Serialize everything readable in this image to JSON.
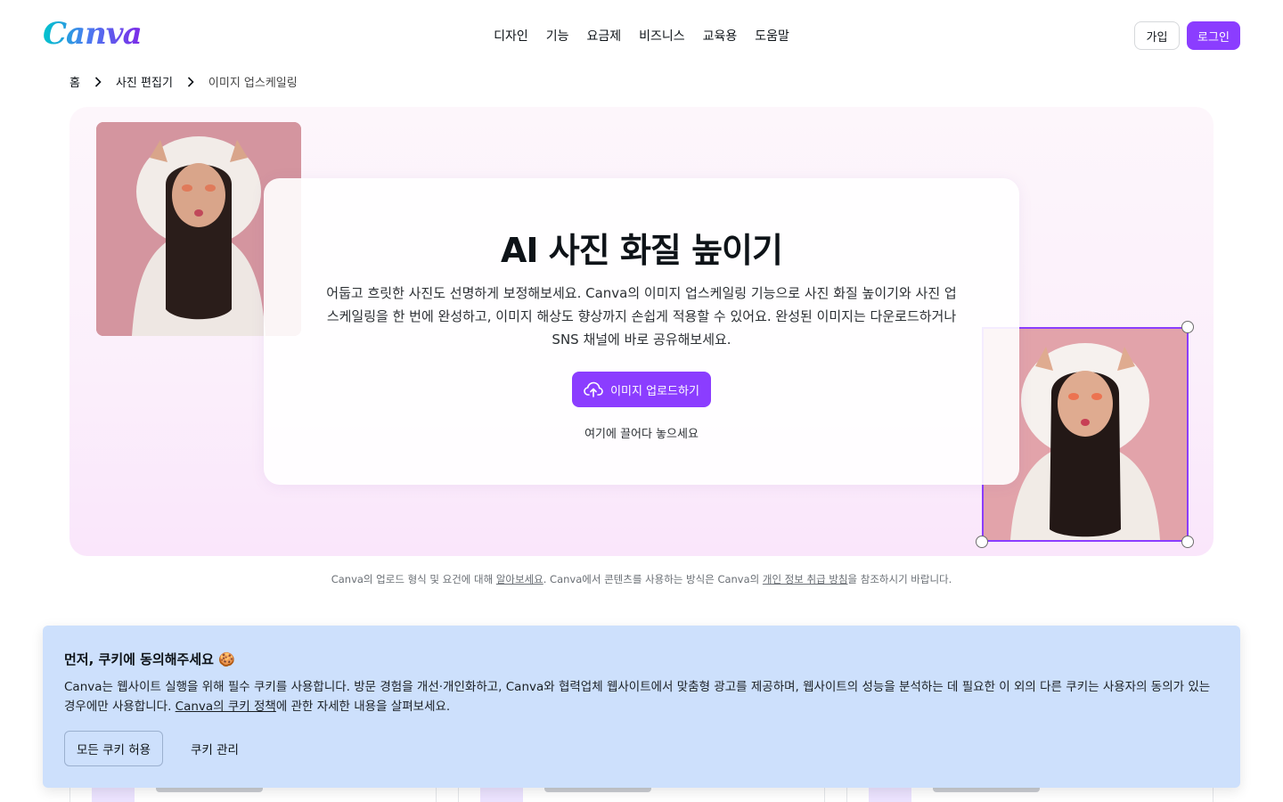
{
  "brand": {
    "name": "Canva",
    "accent": "#8b3dff"
  },
  "nav": {
    "items": [
      {
        "label": "디자인"
      },
      {
        "label": "기능"
      },
      {
        "label": "요금제"
      },
      {
        "label": "비즈니스"
      },
      {
        "label": "교육용"
      },
      {
        "label": "도움말"
      }
    ],
    "signup_label": "가입",
    "login_label": "로그인"
  },
  "breadcrumb": {
    "home": "홈",
    "parent": "사진 편집기",
    "current": "이미지 업스케일링"
  },
  "hero": {
    "title": "AI 사진 화질 높이기",
    "description": "어둡고 흐릿한 사진도 선명하게 보정해보세요. Canva의 이미지 업스케일링 기능으로 사진 화질 높이기와 사진 업스케일링을 한 번에 완성하고, 이미지 해상도 향상까지 손쉽게 적용할 수 있어요. 완성된 이미지는 다운로드하거나 SNS 채널에 바로 공유해보세요.",
    "upload_label": "이미지 업로드하기",
    "drop_text": "여기에 끌어다 놓으세요"
  },
  "notice": {
    "part1": "Canva의 업로드 형식 및 요건에 대해 ",
    "link1": "알아보세요",
    "part2": ". Canva에서 콘텐츠를 사용하는 방식은 Canva의 ",
    "link2": "개인 정보 취급 방침",
    "part3": "을 참조하시기 바랍니다."
  },
  "cookie": {
    "title": "먼저, 쿠키에 동의해주세요 🍪",
    "body": "Canva는 웹사이트 실행을 위해 필수 쿠키를 사용합니다. 방문 경험을 개선·개인화하고, Canva와 협력업체 웹사이트에서 맞춤형 광고를 제공하며, 웹사이트의 성능을 분석하는 데 필요한 이 외의 다른 쿠키는 사용자의 동의가 있는 경우에만 사용합니다. ",
    "policy_link": "Canva의 쿠키 정책",
    "body_end": "에 관한 자세한 내용을 살펴보세요.",
    "accept_label": "모든 쿠키 허용",
    "manage_label": "쿠키 관리"
  }
}
